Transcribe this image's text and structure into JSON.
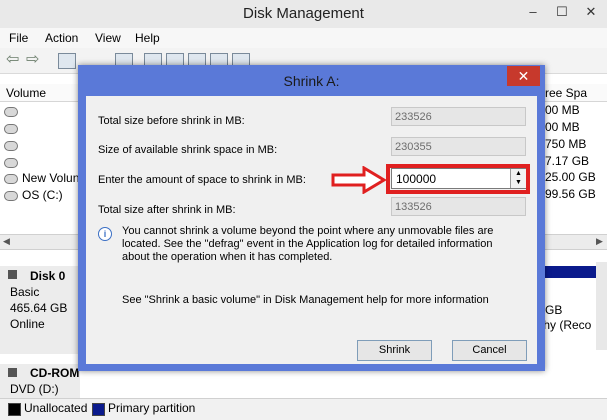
{
  "window": {
    "title": "Disk Management",
    "minimize": "–",
    "maximize": "☐",
    "close": "✕"
  },
  "menu": [
    "File",
    "Action",
    "View",
    "Help"
  ],
  "volume_list": {
    "headers": {
      "volume": "Volume",
      "free_space": "ree Spa"
    },
    "rows": [
      {
        "name": "",
        "free": "00 MB"
      },
      {
        "name": "",
        "free": "00 MB"
      },
      {
        "name": "",
        "free": "750 MB"
      },
      {
        "name": "",
        "free": "7.17 GB"
      },
      {
        "name": "New Volun",
        "free": "25.00 GB"
      },
      {
        "name": "OS (C:)",
        "free": "99.56 GB"
      }
    ]
  },
  "disks": [
    {
      "name": "Disk 0",
      "type": "Basic",
      "size": "465.64 GB",
      "status": "Online",
      "partition_size": "GB",
      "partition_status": "thy (Reco"
    },
    {
      "name": "CD-ROM",
      "type": "DVD (D:)"
    }
  ],
  "legend": {
    "unallocated": "Unallocated",
    "primary": "Primary partition",
    "unallocated_color": "#000000",
    "primary_color": "#0a1a8c"
  },
  "dialog": {
    "title": "Shrink A:",
    "close": "✕",
    "total_before_label": "Total size before shrink in MB:",
    "total_before_value": "233526",
    "available_label": "Size of available shrink space in MB:",
    "available_value": "230355",
    "enter_label": "Enter the amount of space to shrink in MB:",
    "enter_value": "100000",
    "after_label": "Total size after shrink in MB:",
    "after_value": "133526",
    "info": "You cannot shrink a volume beyond the point where any unmovable files are located. See the \"defrag\" event in the Application log for detailed information about the operation when it has completed.",
    "help": "See \"Shrink a basic volume\" in Disk Management help for more information",
    "shrink_button": "Shrink",
    "cancel_button": "Cancel",
    "accent": "#5a79d8",
    "highlight": "#e02020"
  }
}
